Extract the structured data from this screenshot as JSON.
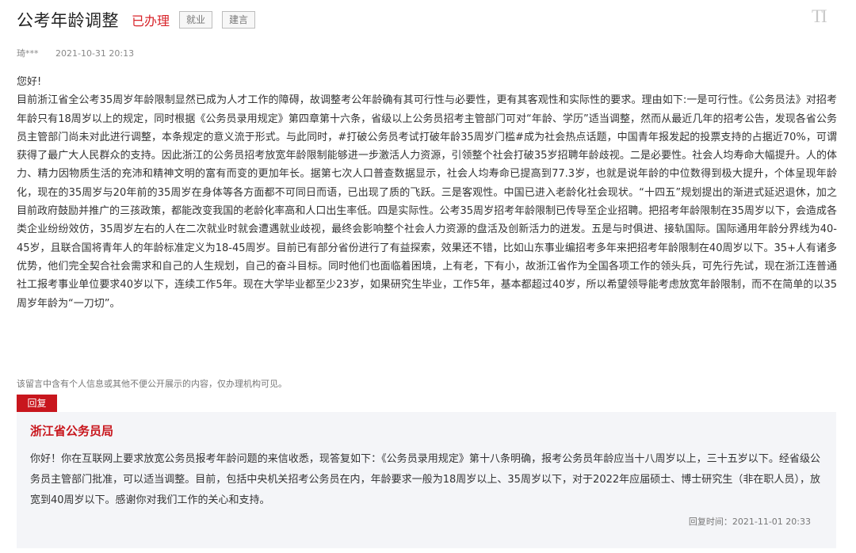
{
  "header": {
    "title": "公考年龄调整",
    "status": "已办理",
    "tags": [
      "就业",
      "建言"
    ],
    "font_toggle": "TI"
  },
  "meta": {
    "author": "琦***",
    "time": "2021-10-31 20:13"
  },
  "message": {
    "greeting": "您好!",
    "body": "目前浙江省全公考35周岁年龄限制显然已成为人才工作的障碍，故调整考公年龄确有其可行性与必要性，更有其客观性和实际性的要求。理由如下:一是可行性。《公务员法》对招考年龄只有18周岁以上的规定，同时根据《公务员录用规定》第四章第十六条，省级以上公务员招考主管部门可对“年龄、学历”适当调整，然而从最近几年的招考公告，发现各省公务员主管部门尚未对此进行调整，本条规定的意义流于形式。与此同时，#打破公务员考试打破年龄35周岁门槛#成为社会热点话题，中国青年报发起的投票支持的占据近70%，可谓获得了最广大人民群众的支持。因此浙江的公务员招考放宽年龄限制能够进一步激活人力资源，引领整个社会打破35岁招聘年龄歧视。二是必要性。社会人均寿命大幅提升。人的体力、精力因物质生活的充沛和精神文明的富有而变的更加年长。据第七次人口普查数据显示，社会人均寿命已提高到77.3岁，也就是说年龄的中位数得到极大提升，个体呈现年龄化，现在的35周岁与20年前的35周岁在身体等各方面都不可同日而语，已出现了质的飞跃。三是客观性。中国已进入老龄化社会现状。“十四五”规划提出的渐进式延迟退休，加之目前政府鼓励并推广的三孩政策，都能改变我国的老龄化率高和人口出生率低。四是实际性。公考35周岁招考年龄限制已传导至企业招聘。把招考年龄限制在35周岁以下，会造成各类企业纷纷效仿，35周岁左右的人在二次就业时就会遭遇就业歧视，最终会影响整个社会人力资源的盘活及创新活力的迸发。五是与时俱进、接轨国际。国际通用年龄分界线为40-45岁，且联合国将青年人的年龄标准定义为18-45周岁。目前已有部分省份进行了有益探索，效果还不错，比如山东事业编招考多年来把招考年龄限制在40周岁以下。35+人有诸多优势，他们完全契合社会需求和自己的人生规划，自己的奋斗目标。同时他们也面临着困境，上有老，下有小，故浙江省作为全国各项工作的领头兵，可先行先试，现在浙江连普通社工报考事业单位要求40岁以下，连续工作5年。现在大学毕业都至少23岁，如果研究生毕业，工作5年，基本都超过40岁，所以希望领导能考虑放宽年龄限制，而不在简单的以35周岁年龄为“一刀切”。"
  },
  "privacy_note": "该留言中含有个人信息或其他不便公开展示的内容，仅办理机构可见。",
  "reply": {
    "badge": "回复",
    "org": "浙江省公务员局",
    "content": "你好！你在互联网上要求放宽公务员报考年龄问题的来信收悉，现答复如下：《公务员录用规定》第十八条明确，报考公务员年龄应当十八周岁以上，三十五岁以下。经省级公务员主管部门批准，可以适当调整。目前，包括中央机关招考公务员在内，年龄要求一般为18周岁以上、35周岁以下，对于2022年应届硕士、博士研究生（非在职人员），放宽到40周岁以下。感谢你对我们工作的关心和支持。",
    "time_label": "回复时间：",
    "time": "2021-11-01 20:33"
  },
  "colors": {
    "accent_red": "#c8161d",
    "status_red": "#d8242a",
    "reply_bg": "#f4f5f8"
  }
}
